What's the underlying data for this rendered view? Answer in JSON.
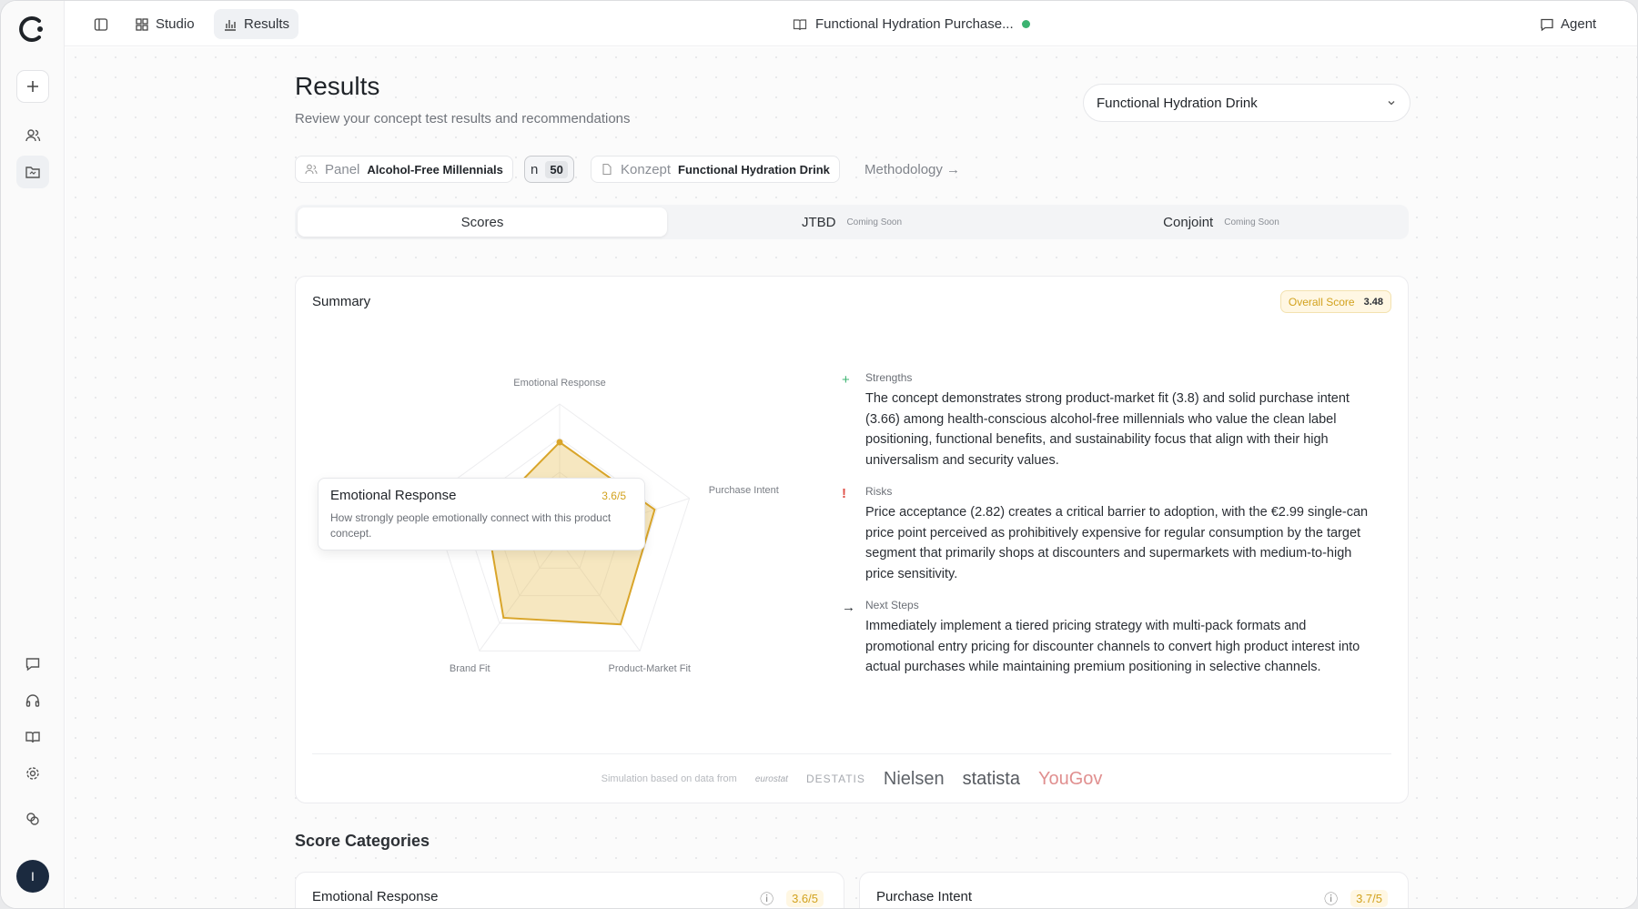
{
  "topbar": {
    "studio_label": "Studio",
    "results_label": "Results",
    "document_title": "Functional Hydration Purchase...",
    "agent_label": "Agent"
  },
  "user": {
    "initial": "I"
  },
  "page": {
    "title": "Results",
    "subtitle": "Review your concept test results and recommendations",
    "concept_select": "Functional Hydration Drink"
  },
  "filters": {
    "panel_label": "Panel",
    "panel_value": "Alcohol-Free Millennials",
    "n_label": "n",
    "n_value": "50",
    "concept_label": "Konzept",
    "concept_value": "Functional Hydration Drink",
    "methodology_label": "Methodology →"
  },
  "tabs": [
    {
      "label": "Scores",
      "tag": ""
    },
    {
      "label": "JTBD",
      "tag": "Coming Soon"
    },
    {
      "label": "Conjoint",
      "tag": "Coming Soon"
    }
  ],
  "summary": {
    "title": "Summary",
    "overall_label": "Overall Score",
    "overall_value": "3.48",
    "tooltip": {
      "title": "Emotional Response",
      "value": "3.6/5",
      "description": "How strongly people emotionally connect with this product concept."
    },
    "strengths_label": "Strengths",
    "strengths_text": "The concept demonstrates strong product-market fit (3.8) and solid purchase intent (3.66) among health-conscious alcohol-free millennials who value the clean label positioning, functional benefits, and sustainability focus that align with their high universalism and security values.",
    "risks_label": "Risks",
    "risks_text": "Price acceptance (2.82) creates a critical barrier to adoption, with the €2.99 single-can price point perceived as prohibitively expensive for regular consumption by the target segment that primarily shops at discounters and supermarkets with medium-to-high price sensitivity.",
    "next_label": "Next Steps",
    "next_text": "Immediately implement a tiered pricing strategy with multi-pack formats and promotional entry pricing for discounter channels to convert high product interest into actual purchases while maintaining premium positioning in selective channels.",
    "sources_caption": "Simulation based on data from",
    "sources": [
      "eurostat",
      "DESTATIS",
      "Nielsen",
      "statista",
      "YouGov"
    ]
  },
  "chart_data": {
    "type": "radar",
    "categories": [
      "Emotional Response",
      "Purchase Intent",
      "Product-Market Fit",
      "Brand Fit",
      "Price Acceptance"
    ],
    "values": [
      3.6,
      3.66,
      3.8,
      3.5,
      2.82
    ],
    "max": 5,
    "color": "#e5b94a"
  },
  "score_categories": {
    "title": "Score Categories",
    "items": [
      {
        "label": "Emotional Response",
        "value": "3.6/5"
      },
      {
        "label": "Purchase Intent",
        "value": "3.7/5"
      }
    ]
  },
  "colors": {
    "accent": "#d2a21e",
    "status": "#3cb371"
  }
}
